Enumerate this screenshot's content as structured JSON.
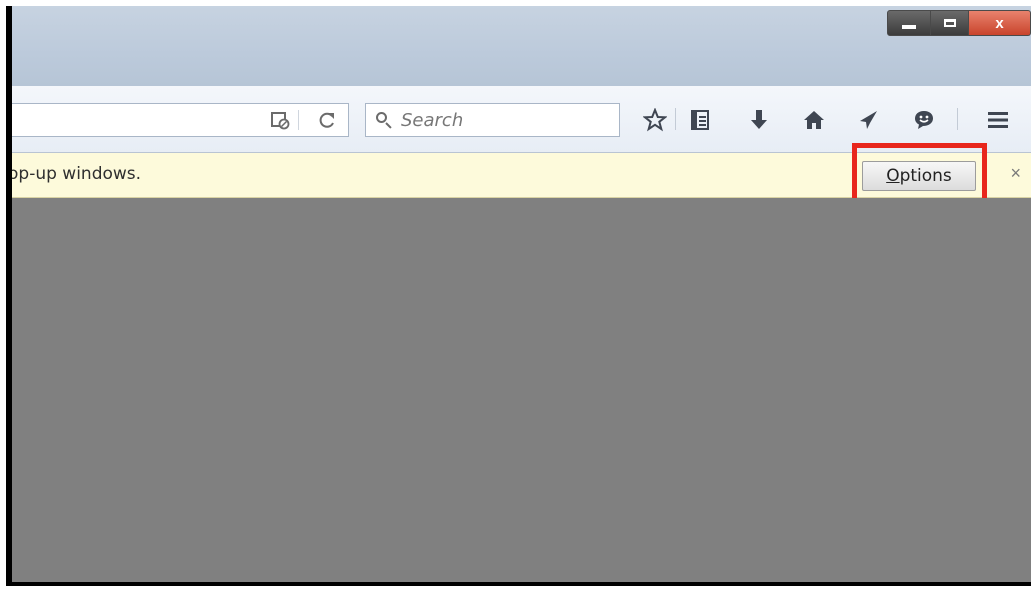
{
  "titlebar": {
    "minimize_icon": "minimize-icon",
    "maximize_icon": "maximize-icon",
    "close_label": "x"
  },
  "navbar": {
    "search": {
      "placeholder": "Search"
    },
    "icons": [
      "reader-view-icon",
      "reload-icon",
      "bookmark-star-icon",
      "reading-list-icon",
      "download-icon",
      "home-icon",
      "send-icon",
      "chat-icon",
      "menu-icon"
    ]
  },
  "notification": {
    "message": "op-up windows.",
    "options_prefix": "O",
    "options_rest": "ptions",
    "close_label": "×"
  },
  "colors": {
    "highlight": "#e8261c",
    "notification_bg": "#fdfadb",
    "content_bg": "#808080"
  }
}
